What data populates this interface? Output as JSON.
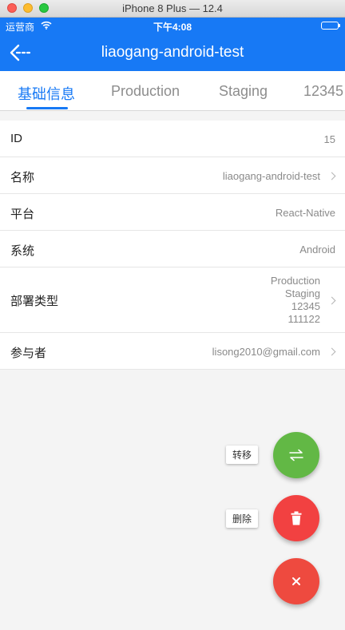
{
  "window": {
    "title": "iPhone 8 Plus — 12.4"
  },
  "status_bar": {
    "carrier": "运营商",
    "time": "下午4:08"
  },
  "navbar": {
    "title": "liaogang-android-test"
  },
  "tabs": [
    {
      "label": "基础信息",
      "active": true
    },
    {
      "label": "Production",
      "active": false
    },
    {
      "label": "Staging",
      "active": false
    },
    {
      "label": "12345",
      "active": false
    }
  ],
  "rows": [
    {
      "label": "ID",
      "value": "15",
      "chevron": false
    },
    {
      "label": "名称",
      "value": "liaogang-android-test",
      "chevron": true
    },
    {
      "label": "平台",
      "value": "React-Native",
      "chevron": false
    },
    {
      "label": "系统",
      "value": "Android",
      "chevron": false
    },
    {
      "label": "部署类型",
      "values": [
        "Production",
        "Staging",
        "12345",
        "111122"
      ],
      "chevron": true
    },
    {
      "label": "参与者",
      "value": "lisong2010@gmail.com",
      "chevron": true
    }
  ],
  "fab": {
    "transfer_label": "转移",
    "delete_label": "删除",
    "transfer_color": "#62b845",
    "delete_color": "#f24141",
    "close_color": "#ee4a3f"
  },
  "colors": {
    "primary": "#1779f5"
  }
}
